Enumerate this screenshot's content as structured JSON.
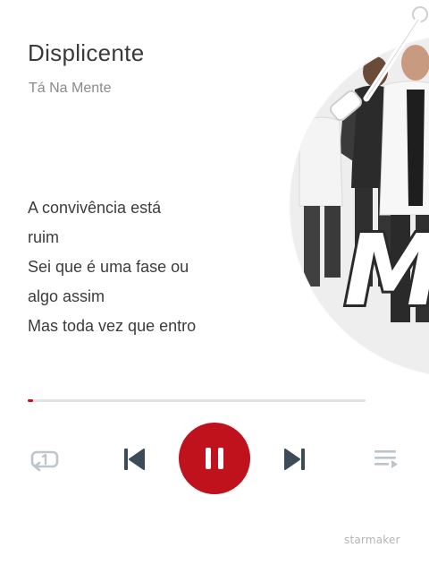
{
  "song": {
    "title": "Displicente",
    "artist": "Tá Na Mente"
  },
  "album_art": {
    "logo_text": "Mé"
  },
  "lyrics": [
    "A convivência está",
    "ruim",
    "Sei que é uma fase ou",
    "algo assim",
    "Mas toda vez que entro"
  ],
  "playback": {
    "progress_fraction": 0.015,
    "state": "playing"
  },
  "controls": {
    "repeat_icon": "repeat-one-icon",
    "previous_icon": "skip-previous-icon",
    "pause_icon": "pause-icon",
    "next_icon": "skip-next-icon",
    "playlist_icon": "playlist-icon"
  },
  "colors": {
    "accent": "#c0121d",
    "track": "#e2e2e2",
    "icon_dark": "#3d4a57",
    "icon_light": "#bcc4cc"
  },
  "watermark": "starmaker"
}
